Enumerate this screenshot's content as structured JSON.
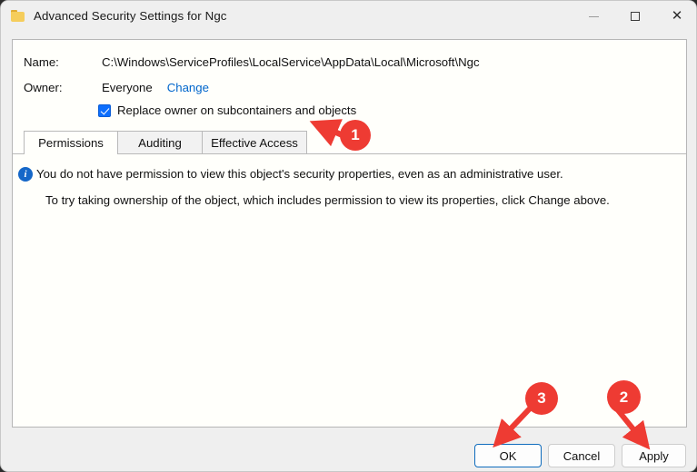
{
  "window": {
    "title": "Advanced Security Settings for Ngc",
    "icon": "folder-icon",
    "caption": {
      "minimize": "—",
      "maximize": "□",
      "close": "✕"
    }
  },
  "header": {
    "name_label": "Name:",
    "name_value": "C:\\Windows\\ServiceProfiles\\LocalService\\AppData\\Local\\Microsoft\\Ngc",
    "owner_label": "Owner:",
    "owner_value": "Everyone",
    "change_link": "Change",
    "replace_owner_checkbox_label": "Replace owner on subcontainers and objects",
    "replace_owner_checked": true
  },
  "tabs": [
    {
      "label": "Permissions",
      "selected": true
    },
    {
      "label": "Auditing",
      "selected": false
    },
    {
      "label": "Effective Access",
      "selected": false
    }
  ],
  "body": {
    "info_icon": "info-icon",
    "info_message": "You do not have permission to view this object's security properties, even as an administrative user.",
    "info_detail": "To try taking ownership of the object, which includes permission to view its properties, click Change above."
  },
  "footer": {
    "ok_label": "OK",
    "cancel_label": "Cancel",
    "apply_label": "Apply"
  },
  "annotations": [
    {
      "number": "1",
      "target": "replace-owner-checkbox"
    },
    {
      "number": "2",
      "target": "apply-button"
    },
    {
      "number": "3",
      "target": "ok-button"
    }
  ],
  "colors": {
    "accent_link": "#0066cc",
    "annotation_red": "#ee3b33",
    "checkbox_blue": "#0d6efd",
    "default_button_border": "#0f6cbd",
    "info_blue": "#1567c8"
  }
}
